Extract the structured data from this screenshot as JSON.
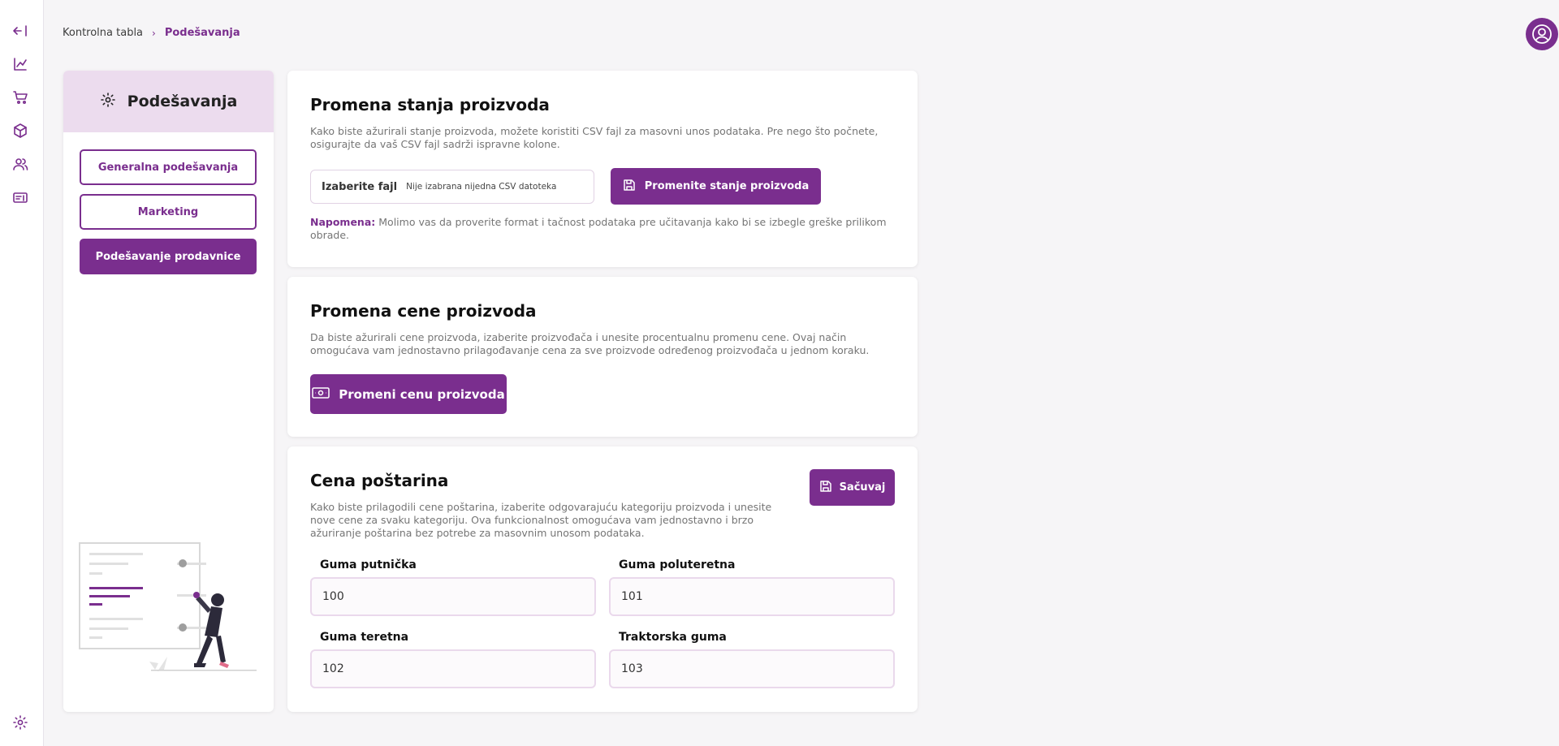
{
  "rail": {
    "icons": [
      "collapse-sidebar-icon",
      "chart-icon",
      "cart-icon",
      "box-icon",
      "users-icon",
      "ticket-icon",
      "settings-icon"
    ]
  },
  "breadcrumb": {
    "home": "Kontrolna tabla",
    "separator": "›",
    "current": "Podešavanja"
  },
  "sidebar": {
    "title": "Podešavanja",
    "items": [
      {
        "label": "Generalna podešavanja",
        "active": false
      },
      {
        "label": "Marketing",
        "active": false
      },
      {
        "label": "Podešavanje prodavnice",
        "active": true
      }
    ]
  },
  "stock_card": {
    "title": "Promena stanja proizvoda",
    "description": "Kako biste ažurirali stanje proizvoda, možete koristiti CSV fajl za masovni unos podataka. Pre nego što počnete, osigurajte da vaš CSV fajl sadrži ispravne kolone.",
    "file_label": "Izaberite fajl",
    "file_value": "Nije izabrana nijedna CSV datoteka",
    "button_label": "Promenite stanje proizvoda",
    "note_label": "Napomena:",
    "note_text": "Molimo vas da proverite format i tačnost podataka pre učitavanja kako bi se izbegle greške prilikom obrade."
  },
  "price_card": {
    "title": "Promena cene proizvoda",
    "description": "Da biste ažurirali cene proizvoda, izaberite proizvođača i unesite procentualnu promenu cene. Ovaj način omogućava vam jednostavno prilagođavanje cena za sve proizvode određenog proizvođača u jednom koraku.",
    "button_label": "Promeni cenu proizvoda"
  },
  "shipping_card": {
    "title": "Cena poštarina",
    "description": "Kako biste prilagodili cene poštarina, izaberite odgovarajuću kategoriju proizvoda i unesite nove cene za svaku kategoriju. Ova funkcionalnost omogućava vam jednostavno i brzo ažuriranje poštarina bez potrebe za masovnim unosom podataka.",
    "save_label": "Sačuvaj",
    "fields": [
      {
        "label": "Guma putnička",
        "value": "100"
      },
      {
        "label": "Guma poluteretna",
        "value": "101"
      },
      {
        "label": "Guma teretna",
        "value": "102"
      },
      {
        "label": "Traktorska guma",
        "value": "103"
      }
    ]
  },
  "colors": {
    "accent": "#7a2e8e",
    "accent_light": "#ecdcee",
    "background": "#f6f5f7"
  }
}
